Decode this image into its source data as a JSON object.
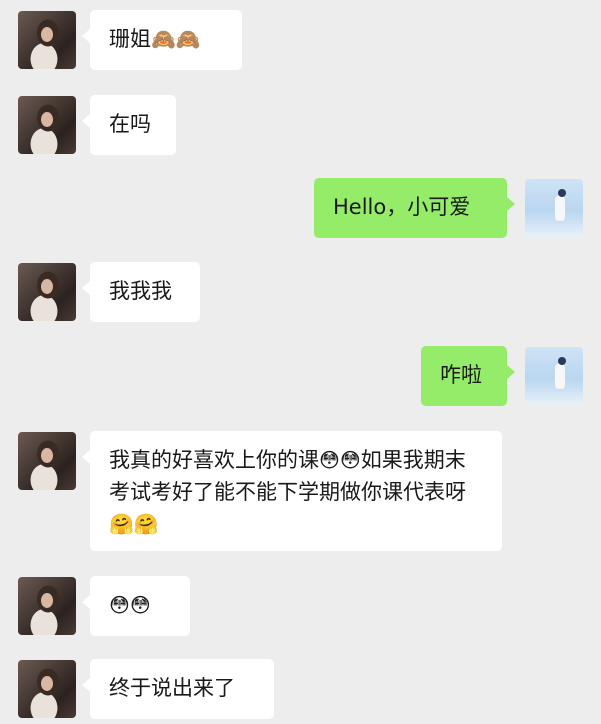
{
  "messages": [
    {
      "side": "left",
      "text": "珊姐",
      "emoji": "🙈🙈"
    },
    {
      "side": "left",
      "text": "在吗",
      "emoji": ""
    },
    {
      "side": "right",
      "text": "Hello，小可爱",
      "emoji": ""
    },
    {
      "side": "left",
      "text": "我我我",
      "emoji": ""
    },
    {
      "side": "right",
      "text": "咋啦",
      "emoji": ""
    },
    {
      "side": "left",
      "text": "我真的好喜欢上你的课",
      "emoji": "😳😳",
      "text2": "如果我期末考试考好了能不能下学期做你课代表呀",
      "emoji2": "🤗🤗"
    },
    {
      "side": "left",
      "text": "",
      "emoji": "😳😳"
    },
    {
      "side": "left",
      "text": "终于说出来了",
      "emoji": ""
    }
  ],
  "colors": {
    "background": "#ededed",
    "bubble_left": "#ffffff",
    "bubble_right": "#95ec69"
  }
}
